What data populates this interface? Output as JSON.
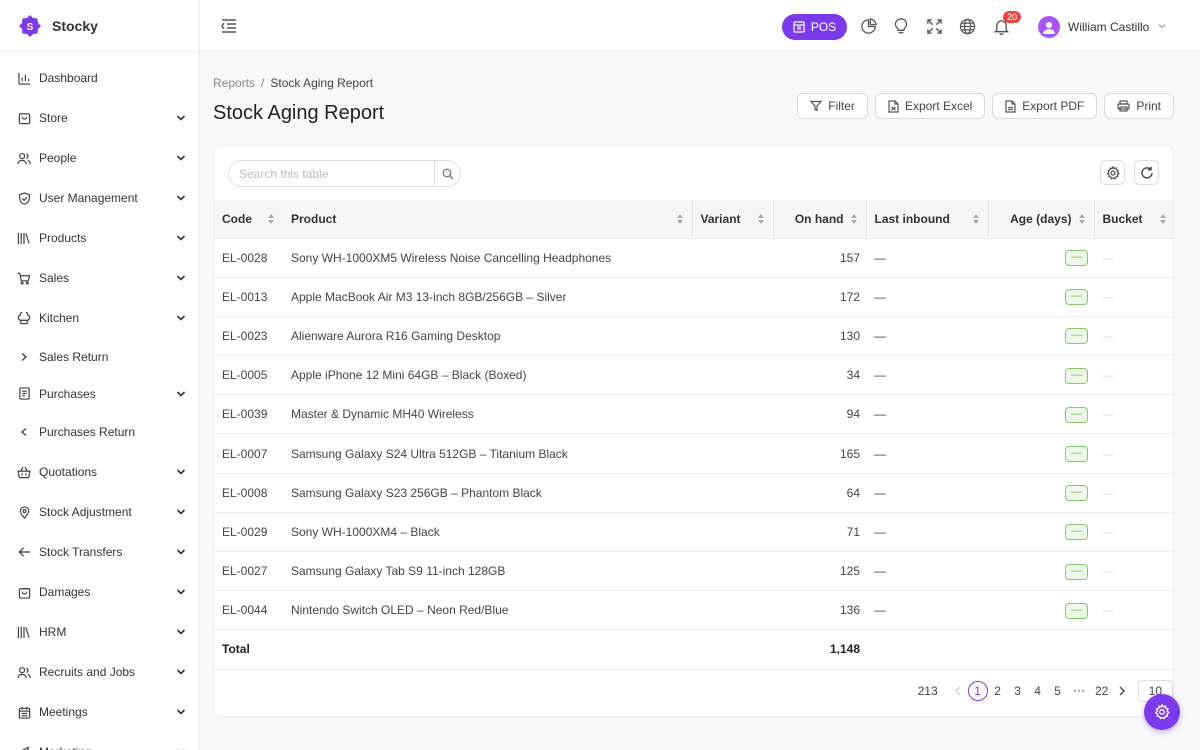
{
  "brand": {
    "name": "Stocky"
  },
  "sidebar": {
    "items": [
      {
        "label": "Dashboard",
        "icon": "chart-icon",
        "chevron": "none"
      },
      {
        "label": "Store",
        "icon": "store-icon",
        "chevron": "down"
      },
      {
        "label": "People",
        "icon": "people-icon",
        "chevron": "down"
      },
      {
        "label": "User Management",
        "icon": "shield-icon",
        "chevron": "down"
      },
      {
        "label": "Products",
        "icon": "products-icon",
        "chevron": "down"
      },
      {
        "label": "Sales",
        "icon": "cart-icon",
        "chevron": "down"
      },
      {
        "label": "Kitchen",
        "icon": "chef-hat-icon",
        "chevron": "down"
      },
      {
        "label": "Sales Return",
        "icon": "chevron-right-icon",
        "chevron": "none"
      },
      {
        "label": "Purchases",
        "icon": "receipt-icon",
        "chevron": "down"
      },
      {
        "label": "Purchases Return",
        "icon": "chevron-left-icon",
        "chevron": "none"
      },
      {
        "label": "Quotations",
        "icon": "basket-icon",
        "chevron": "down"
      },
      {
        "label": "Stock Adjustment",
        "icon": "location-icon",
        "chevron": "down"
      },
      {
        "label": "Stock Transfers",
        "icon": "arrow-left-icon",
        "chevron": "down"
      },
      {
        "label": "Damages",
        "icon": "bag-icon",
        "chevron": "down"
      },
      {
        "label": "HRM",
        "icon": "library-icon",
        "chevron": "down"
      },
      {
        "label": "Recruits and Jobs",
        "icon": "people-icon",
        "chevron": "down"
      },
      {
        "label": "Meetings",
        "icon": "calendar-icon",
        "chevron": "down"
      },
      {
        "label": "Marketing",
        "icon": "megaphone-icon",
        "chevron": "down"
      }
    ]
  },
  "topbar": {
    "pos_label": "POS",
    "notification_count": "20",
    "user_name": "William Castillo"
  },
  "page": {
    "breadcrumb_parent": "Reports",
    "breadcrumb_sep": "/",
    "breadcrumb_current": "Stock Aging Report",
    "title": "Stock Aging Report"
  },
  "actions": {
    "filter": "Filter",
    "export_excel": "Export Excel",
    "export_pdf": "Export PDF",
    "print": "Print"
  },
  "search": {
    "placeholder": "Search this table"
  },
  "table": {
    "columns": [
      "Code",
      "Product",
      "Variant",
      "On hand",
      "Last inbound",
      "Age (days)",
      "Bucket"
    ],
    "rows": [
      {
        "code": "EL-0028",
        "product": "Sony WH-1000XM5 Wireless Noise Cancelling Headphones",
        "variant": "",
        "on_hand": "157",
        "last_inbound": "—",
        "age": "—",
        "bucket": "—"
      },
      {
        "code": "EL-0013",
        "product": "Apple MacBook Air M3 13-inch 8GB/256GB – Silver",
        "variant": "",
        "on_hand": "172",
        "last_inbound": "—",
        "age": "—",
        "bucket": "—"
      },
      {
        "code": "EL-0023",
        "product": "Alienware Aurora R16 Gaming Desktop",
        "variant": "",
        "on_hand": "130",
        "last_inbound": "—",
        "age": "—",
        "bucket": "—"
      },
      {
        "code": "EL-0005",
        "product": "Apple iPhone 12 Mini 64GB – Black (Boxed)",
        "variant": "",
        "on_hand": "34",
        "last_inbound": "—",
        "age": "—",
        "bucket": "—"
      },
      {
        "code": "EL-0039",
        "product": "Master & Dynamic MH40 Wireless",
        "variant": "",
        "on_hand": "94",
        "last_inbound": "—",
        "age": "—",
        "bucket": "—"
      },
      {
        "code": "EL-0007",
        "product": "Samsung Galaxy S24 Ultra 512GB – Titanium Black",
        "variant": "",
        "on_hand": "165",
        "last_inbound": "—",
        "age": "—",
        "bucket": "—"
      },
      {
        "code": "EL-0008",
        "product": "Samsung Galaxy S23 256GB – Phantom Black",
        "variant": "",
        "on_hand": "64",
        "last_inbound": "—",
        "age": "—",
        "bucket": "—"
      },
      {
        "code": "EL-0029",
        "product": "Sony WH-1000XM4 – Black",
        "variant": "",
        "on_hand": "71",
        "last_inbound": "—",
        "age": "—",
        "bucket": "—"
      },
      {
        "code": "EL-0027",
        "product": "Samsung Galaxy Tab S9 11-inch 128GB",
        "variant": "",
        "on_hand": "125",
        "last_inbound": "—",
        "age": "—",
        "bucket": "—"
      },
      {
        "code": "EL-0044",
        "product": "Nintendo Switch OLED – Neon Red/Blue",
        "variant": "",
        "on_hand": "136",
        "last_inbound": "—",
        "age": "—",
        "bucket": "—"
      }
    ],
    "total_label": "Total",
    "total_on_hand": "1,148"
  },
  "pagination": {
    "total": "213",
    "pages": [
      "1",
      "2",
      "3",
      "4",
      "5"
    ],
    "ellipsis": "•••",
    "last": "22",
    "page_size": "10"
  },
  "colors": {
    "accent": "#7c3aed",
    "badge": "#ef4444",
    "age_pill": "#86c86a"
  }
}
